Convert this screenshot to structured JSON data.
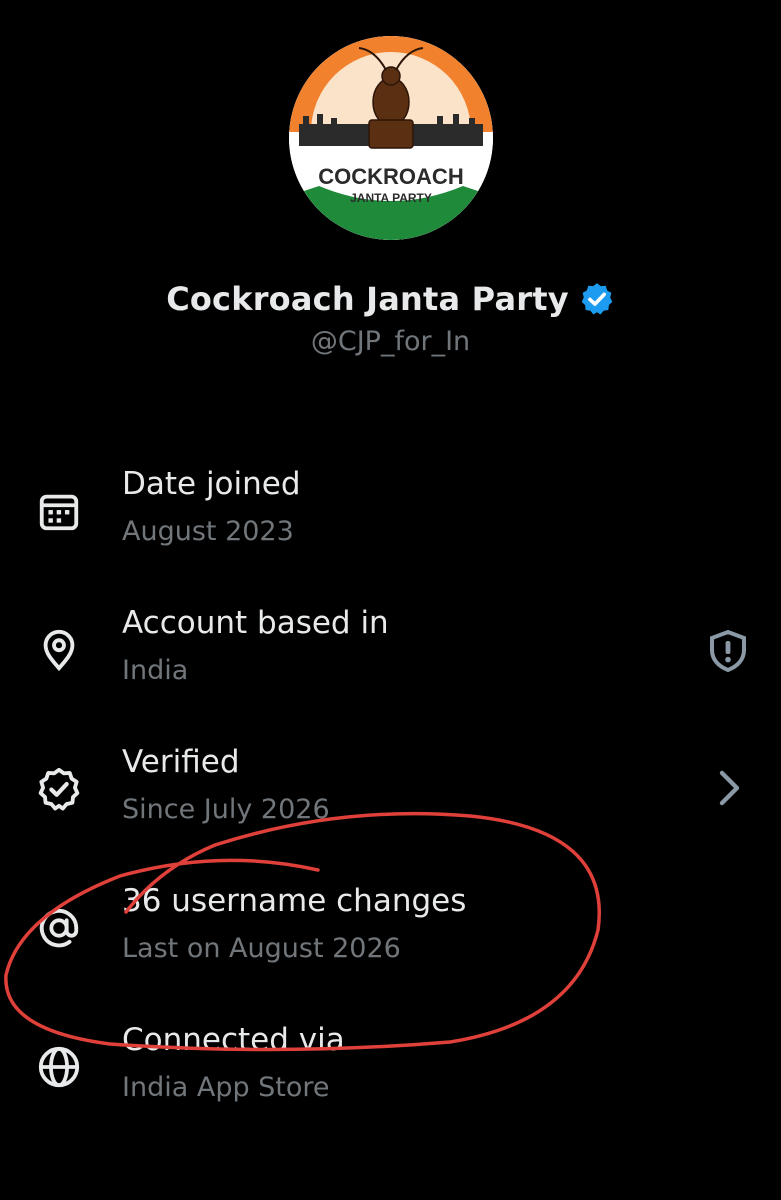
{
  "profile": {
    "avatar_text_main": "COCKROACH",
    "avatar_text_sub": "JANTA PARTY",
    "display_name": "Cockroach Janta Party",
    "handle": "@CJP_for_In",
    "verified_icon": "verified-badge-icon"
  },
  "rows": [
    {
      "icon": "calendar-icon",
      "title": "Date joined",
      "subtitle": "August 2023"
    },
    {
      "icon": "location-pin-icon",
      "title": "Account based in",
      "subtitle": "India",
      "trailing_icon": "shield-alert-icon"
    },
    {
      "icon": "verified-seal-icon",
      "title": "Verified",
      "subtitle": "Since July 2026",
      "trailing_icon": "chevron-right-icon"
    },
    {
      "icon": "at-sign-icon",
      "title": "36 username changes",
      "subtitle": "Last on August 2026"
    },
    {
      "icon": "globe-icon",
      "title": "Connected via",
      "subtitle": "India App Store"
    }
  ],
  "colors": {
    "background": "#000000",
    "primary_text": "#e7e9ea",
    "secondary_text": "#71767b",
    "verified_blue": "#1d9bf0",
    "annotation_red": "#e0403a",
    "saffron": "#f07a22",
    "green": "#1f8a3a"
  }
}
